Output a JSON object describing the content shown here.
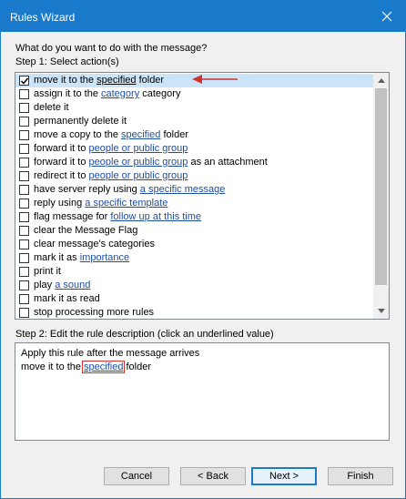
{
  "window": {
    "title": "Rules Wizard"
  },
  "question": "What do you want to do with the message?",
  "step1": {
    "label": "Step 1: Select action(s)",
    "items": [
      {
        "parts": [
          {
            "t": "move it to the "
          },
          {
            "t": "specified",
            "link": true,
            "dark": true
          },
          {
            "t": " folder"
          }
        ],
        "checked": true,
        "selected": true
      },
      {
        "parts": [
          {
            "t": "assign it to the "
          },
          {
            "t": "category",
            "link": true
          },
          {
            "t": " category"
          }
        ],
        "checked": false
      },
      {
        "parts": [
          {
            "t": "delete it"
          }
        ],
        "checked": false
      },
      {
        "parts": [
          {
            "t": "permanently delete it"
          }
        ],
        "checked": false
      },
      {
        "parts": [
          {
            "t": "move a copy to the "
          },
          {
            "t": "specified",
            "link": true
          },
          {
            "t": " folder"
          }
        ],
        "checked": false
      },
      {
        "parts": [
          {
            "t": "forward it to "
          },
          {
            "t": "people or public group",
            "link": true
          }
        ],
        "checked": false
      },
      {
        "parts": [
          {
            "t": "forward it to "
          },
          {
            "t": "people or public group",
            "link": true
          },
          {
            "t": " as an attachment"
          }
        ],
        "checked": false
      },
      {
        "parts": [
          {
            "t": "redirect it to "
          },
          {
            "t": "people or public group",
            "link": true
          }
        ],
        "checked": false
      },
      {
        "parts": [
          {
            "t": "have server reply using "
          },
          {
            "t": "a specific message",
            "link": true
          }
        ],
        "checked": false
      },
      {
        "parts": [
          {
            "t": "reply using "
          },
          {
            "t": "a specific template",
            "link": true
          }
        ],
        "checked": false
      },
      {
        "parts": [
          {
            "t": "flag message for "
          },
          {
            "t": "follow up at this time",
            "link": true
          }
        ],
        "checked": false
      },
      {
        "parts": [
          {
            "t": "clear the Message Flag"
          }
        ],
        "checked": false
      },
      {
        "parts": [
          {
            "t": "clear message's categories"
          }
        ],
        "checked": false
      },
      {
        "parts": [
          {
            "t": "mark it as "
          },
          {
            "t": "importance",
            "link": true
          }
        ],
        "checked": false
      },
      {
        "parts": [
          {
            "t": "print it"
          }
        ],
        "checked": false
      },
      {
        "parts": [
          {
            "t": "play "
          },
          {
            "t": "a sound",
            "link": true
          }
        ],
        "checked": false
      },
      {
        "parts": [
          {
            "t": "mark it as read"
          }
        ],
        "checked": false
      },
      {
        "parts": [
          {
            "t": "stop processing more rules"
          }
        ],
        "checked": false
      }
    ]
  },
  "step2": {
    "label": "Step 2: Edit the rule description (click an underlined value)",
    "line1": "Apply this rule after the message arrives",
    "line2_pre": "move it to the",
    "line2_link": "specified",
    "line2_post": "folder"
  },
  "buttons": {
    "cancel": "Cancel",
    "back": "< Back",
    "next": "Next >",
    "finish": "Finish"
  },
  "colors": {
    "titlebar": "#1979ca",
    "link": "#1f4e9f",
    "annotation": "#d0332b",
    "selection": "#cce4f7"
  }
}
